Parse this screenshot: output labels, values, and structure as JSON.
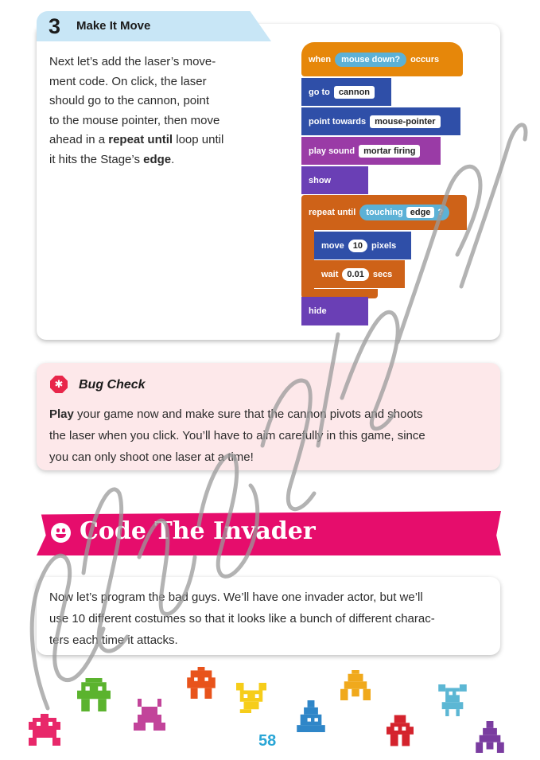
{
  "step": {
    "number": "3",
    "title": "Make It Move",
    "text_lines": [
      "Next let’s add the laser’s move-",
      "ment code. On click, the laser",
      "should go to the cannon, point",
      "to the mouse pointer, then move",
      "ahead in a ",
      "repeat until",
      " loop until",
      "it hits the Stage’s ",
      "edge",
      "."
    ]
  },
  "code": {
    "hat_when": "when",
    "hat_trigger": "mouse down?",
    "hat_occurs": "occurs",
    "goto_label": "go to",
    "goto_target": "cannon",
    "point_label": "point towards",
    "point_target": "mouse-pointer",
    "sound_label": "play sound",
    "sound_name": "mortar firing",
    "show_label": "show",
    "repeat_label": "repeat until",
    "touching_label": "touching",
    "touching_target": "edge",
    "touching_q": "?",
    "move_label": "move",
    "move_value": "10",
    "move_unit": "pixels",
    "wait_label": "wait",
    "wait_value": "0.01",
    "wait_unit": "secs",
    "hide_label": "hide"
  },
  "bug_check": {
    "title": "Bug Check",
    "play_word": "Play",
    "line1_rest": " your game now and make sure that the cannon pivots and shoots",
    "line2": "the laser when you click. You’ll have to aim carefully in this game, since",
    "line3": "you can only shoot one laser at a time!"
  },
  "section": {
    "title": "Code The Invader"
  },
  "intro": {
    "line1": "Now let’s program the bad guys. We’ll have one invader actor, but we’ll",
    "line2": "use 10 different costumes so that it looks like a bunch of different charac-",
    "line3": "ters each time it attacks."
  },
  "page_number": "58",
  "colors": {
    "event": "#e6870a",
    "motion": "#2f4fa8",
    "looks": "#6a3fb5",
    "sound": "#9a3ba6",
    "control": "#ce6218",
    "sensing": "#5cb1d6",
    "banner": "#e60d6c",
    "bug_bg": "#fde8ea",
    "step_header": "#c8e6f6"
  },
  "icons": {
    "bug": "bug-icon",
    "smiley": "smiley-icon",
    "invaders": [
      "invader-pink",
      "invader-green",
      "invader-magenta",
      "invader-orange",
      "invader-yellow",
      "invader-blue",
      "invader-gold",
      "invader-red",
      "invader-cyan",
      "invader-purple"
    ]
  }
}
